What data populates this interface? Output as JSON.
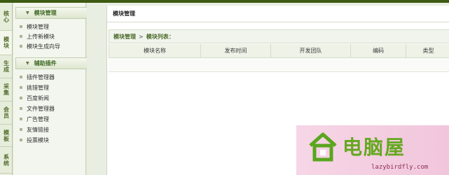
{
  "vertical_tabs": [
    {
      "label": "核心"
    },
    {
      "label": "模块",
      "active": true
    },
    {
      "label": "生成"
    },
    {
      "label": "采集"
    },
    {
      "label": "会员"
    },
    {
      "label": "模板"
    },
    {
      "label": "系统"
    }
  ],
  "sidebar": {
    "groups": [
      {
        "title": "模块管理",
        "items": [
          "模块管理",
          "上传新模块",
          "模块生成向导"
        ]
      },
      {
        "title": "辅助插件",
        "items": [
          "插件管理器",
          "挑错管理",
          "百度新闻",
          "文件管理器",
          "广告管理",
          "友情链接",
          "投票模块"
        ]
      }
    ]
  },
  "panel": {
    "title": "模块管理",
    "breadcrumb": {
      "root": "模块管理",
      "sep": ">",
      "current": "模块列表："
    },
    "table_headers": [
      "模块名称",
      "发布时间",
      "开发团队",
      "编码",
      "类型"
    ]
  },
  "watermark": {
    "text": "电脑屋",
    "url": "lazybirdfly.com"
  },
  "colors": {
    "accent": "#3f6a23",
    "topbar": "#3e5a13",
    "watermark_bg": "#f3cde0"
  }
}
